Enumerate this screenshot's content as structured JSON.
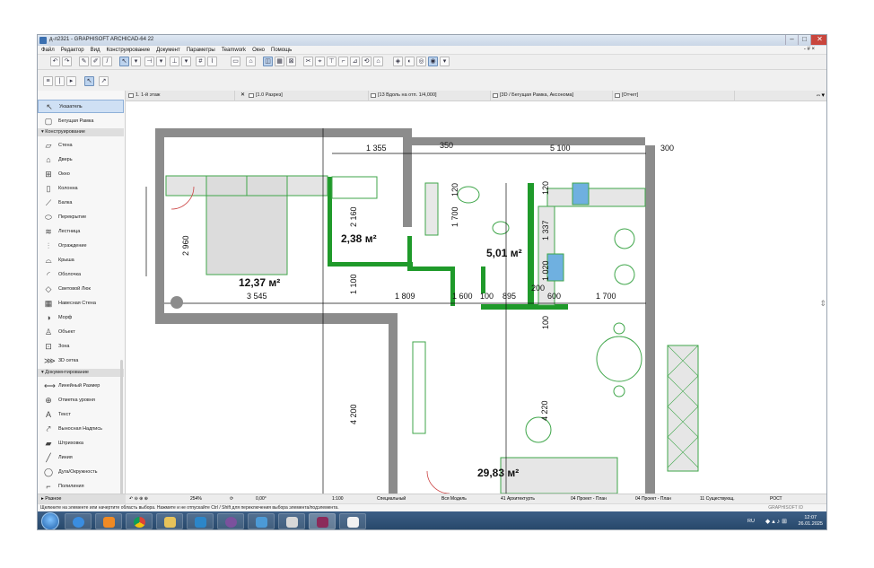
{
  "window": {
    "title": "д-л2321 - GRAPHISOFT ARCHICAD-64 22",
    "buttons": {
      "minimize": "–",
      "maximize": "□",
      "close": "✕"
    }
  },
  "menu": {
    "items": [
      "Файл",
      "Редактор",
      "Вид",
      "Конструирование",
      "Документ",
      "Параметры",
      "Teamwork",
      "Окно",
      "Помощь"
    ],
    "help_mark": "- # ×"
  },
  "tabs": [
    {
      "label": "1. 1-й этаж"
    },
    {
      "label": "[1.0 Разрез]"
    },
    {
      "label": "[13 Вдоль на отп. 1/4,000]"
    },
    {
      "label": "[3D / Бегущая Рамка, Аксонома]"
    },
    {
      "label": "[Отчет]"
    }
  ],
  "toolbox": {
    "top_items": [
      {
        "label": "Указатель",
        "icon": "pointer-icon"
      },
      {
        "label": "Бегущая Рамка",
        "icon": "marquee-icon"
      }
    ],
    "section_design": "Конструирование",
    "design_items": [
      {
        "label": "Стена",
        "icon": "wall-icon"
      },
      {
        "label": "Дверь",
        "icon": "door-icon"
      },
      {
        "label": "Окно",
        "icon": "window-icon"
      },
      {
        "label": "Колонна",
        "icon": "column-icon"
      },
      {
        "label": "Балка",
        "icon": "beam-icon"
      },
      {
        "label": "Перекрытие",
        "icon": "slab-icon"
      },
      {
        "label": "Лестница",
        "icon": "stair-icon"
      },
      {
        "label": "Ограждение",
        "icon": "railing-icon"
      },
      {
        "label": "Крыша",
        "icon": "roof-icon"
      },
      {
        "label": "Оболочка",
        "icon": "shell-icon"
      },
      {
        "label": "Световой Люк",
        "icon": "skylight-icon"
      },
      {
        "label": "Навесная Стена",
        "icon": "curtain-wall-icon"
      },
      {
        "label": "Морф",
        "icon": "morph-icon"
      },
      {
        "label": "Объект",
        "icon": "object-icon"
      },
      {
        "label": "Зона",
        "icon": "zone-icon"
      },
      {
        "label": "3D сетка",
        "icon": "mesh-icon"
      }
    ],
    "section_docs": "Документирование",
    "doc_items": [
      {
        "label": "Линейный Размер",
        "icon": "dimension-icon"
      },
      {
        "label": "Отметка уровня",
        "icon": "level-icon"
      },
      {
        "label": "Текст",
        "icon": "text-icon"
      },
      {
        "label": "Выносная Надпись",
        "icon": "label-icon"
      },
      {
        "label": "Штриховка",
        "icon": "fill-icon"
      },
      {
        "label": "Линия",
        "icon": "line-icon"
      },
      {
        "label": "Дуга/Окружность",
        "icon": "arc-icon"
      },
      {
        "label": "Полилиния",
        "icon": "polyline-icon"
      }
    ],
    "footer": "Разное"
  },
  "plan": {
    "areas": [
      {
        "value": "12,37 м²"
      },
      {
        "value": "2,38 м²"
      },
      {
        "value": "5,01 м²"
      },
      {
        "value": "29,83 м²"
      }
    ],
    "dimensions_top": [
      "1 355",
      "350",
      "5 100",
      "300"
    ],
    "dimensions_mid": [
      "3 545",
      "1 809",
      "1 600",
      "100",
      "895",
      "200",
      "600",
      "1 700"
    ],
    "dimensions_vertical": [
      "2 960",
      "2 160",
      "1 100",
      "1 700",
      "120",
      "1 337",
      "120",
      "1 020",
      "100",
      "4 200",
      "4 220"
    ],
    "colors": {
      "wall": "#8c8c8c",
      "partition": "#1f9a2a",
      "furniture": "#3fa64a",
      "tile_blue": "#6fb0e0"
    }
  },
  "status": {
    "zoom": "254%",
    "angle": "0,00°",
    "scale": "1:100",
    "view": "Специальный",
    "model": "Вся Модель",
    "layer": "41 Архитектурть",
    "proj1": "04 Проект - План",
    "proj2": "04 Проект - План",
    "renov": "11 Существующ.",
    "rfct": "РОСТ"
  },
  "hint": "Щелкните на элементе или начертите область выбора. Нажмите и не отпускайте Ctrl / Shift для переключения выбора элемента/подэлемента.",
  "brand": "GRAPHISOFT ID",
  "taskbar": {
    "lang": "RU",
    "time": "12:07",
    "date": "26.01.2025"
  }
}
